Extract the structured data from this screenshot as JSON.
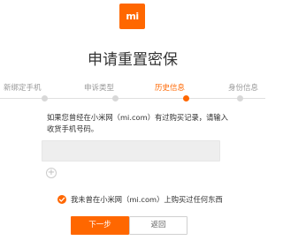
{
  "brand": {
    "logo_text": "mi",
    "color": "#ff6700"
  },
  "page_title": "申请重置密保",
  "steps": [
    {
      "label": "新绑定手机",
      "active": false
    },
    {
      "label": "申诉类型",
      "active": false
    },
    {
      "label": "历史信息",
      "active": true
    },
    {
      "label": "身份信息",
      "active": false
    }
  ],
  "form": {
    "description": "如果您曾经在小米网（mi.com）有过购买记录，请输入收货手机号码。",
    "phone_input": {
      "value": "",
      "placeholder": ""
    },
    "add_icon": "plus-circle-icon",
    "checkbox": {
      "checked": true,
      "icon": "check-circle-icon",
      "label": "我未曾在小米网（mi.com）上购买过任何东西"
    }
  },
  "buttons": {
    "next_label": "下一步",
    "back_label": "返回"
  },
  "colors": {
    "accent": "#ff6700",
    "inactive_step": "#999999",
    "input_bg": "#eeeeee"
  }
}
